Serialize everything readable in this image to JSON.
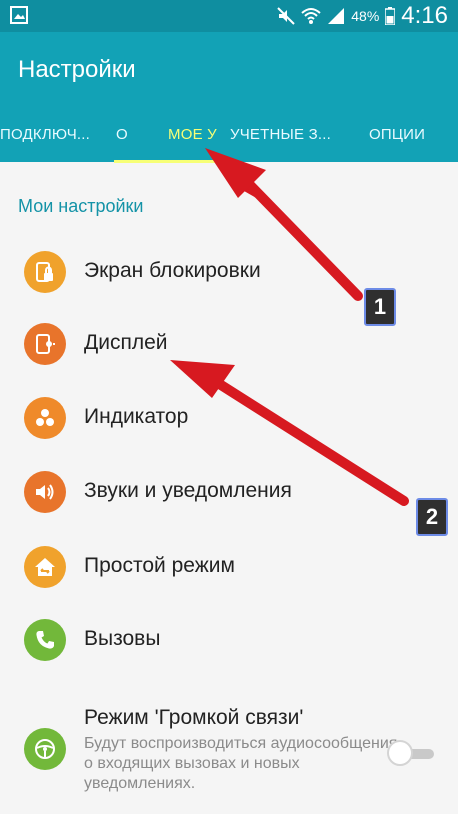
{
  "statusbar": {
    "battery": "48%",
    "time": "4:16"
  },
  "appbar": {
    "title": "Настройки"
  },
  "tabs": [
    {
      "label": "ПОДКЛЮЧ..."
    },
    {
      "label": "О"
    },
    {
      "label": "МОЕ У"
    },
    {
      "label": "УЧЕТНЫЕ З..."
    },
    {
      "label": "ОПЦИИ"
    }
  ],
  "section": {
    "title": "Мои настройки"
  },
  "items": [
    {
      "label": "Экран блокировки",
      "icon": "lock-screen-icon",
      "color": "#f0a22c"
    },
    {
      "label": "Дисплей",
      "icon": "display-icon",
      "color": "#e8742b"
    },
    {
      "label": "Индикатор",
      "icon": "indicator-icon",
      "color": "#ef8a2a"
    },
    {
      "label": "Звуки и уведомления",
      "icon": "sound-icon",
      "color": "#e8742b"
    },
    {
      "label": "Простой режим",
      "icon": "easy-mode-icon",
      "color": "#f0a22c"
    },
    {
      "label": "Вызовы",
      "icon": "phone-icon",
      "color": "#72b83a"
    },
    {
      "label": "Режим 'Громкой связи'",
      "sublabel": "Будут воспроизводиться аудиосообщения о входящих вызовах и новых уведомлениях.",
      "icon": "steering-wheel-icon",
      "color": "#72b83a"
    }
  ],
  "annotations": {
    "badge_1": "1",
    "badge_2": "2",
    "arrow_color": "#d71920"
  }
}
